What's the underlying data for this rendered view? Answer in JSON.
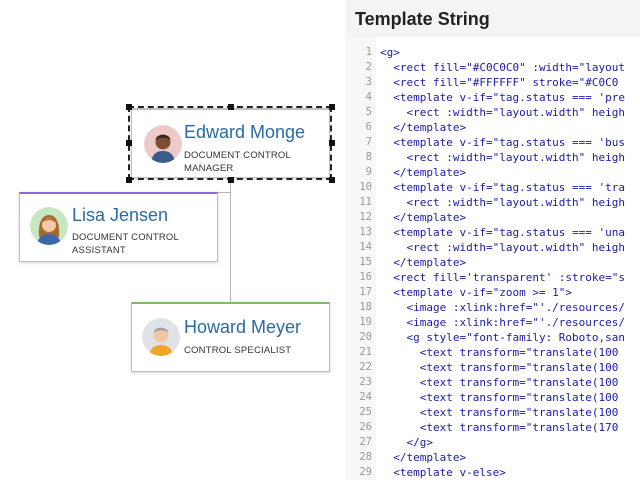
{
  "diagram": {
    "nodes": [
      {
        "id": "edward",
        "name": "Edward Monge",
        "role": "DOCUMENT CONTROL MANAGER",
        "accent": "#C0C0C0"
      },
      {
        "id": "lisa",
        "name": "Lisa Jensen",
        "role": "DOCUMENT CONTROL ASSISTANT",
        "accent": "#8C6AD6"
      },
      {
        "id": "howard",
        "name": "Howard Meyer",
        "role": "CONTROL SPECIALIST",
        "accent": "#7DBB6A"
      }
    ]
  },
  "panel": {
    "title": "Template String"
  },
  "editor": {
    "lines": [
      {
        "n": "1",
        "text": "<g>"
      },
      {
        "n": "2",
        "text": "  <rect fill=\"#C0C0C0\" :width=\"layout"
      },
      {
        "n": "3",
        "text": "  <rect fill=\"#FFFFFF\" stroke=\"#C0C0"
      },
      {
        "n": "4",
        "text": "  <template v-if=\"tag.status === 'pre"
      },
      {
        "n": "5",
        "text": "    <rect :width=\"layout.width\" heigh"
      },
      {
        "n": "6",
        "text": "  </template>"
      },
      {
        "n": "7",
        "text": "  <template v-if=\"tag.status === 'bus"
      },
      {
        "n": "8",
        "text": "    <rect :width=\"layout.width\" heigh"
      },
      {
        "n": "9",
        "text": "  </template>"
      },
      {
        "n": "10",
        "text": "  <template v-if=\"tag.status === 'tra"
      },
      {
        "n": "11",
        "text": "    <rect :width=\"layout.width\" heigh"
      },
      {
        "n": "12",
        "text": "  </template>"
      },
      {
        "n": "13",
        "text": "  <template v-if=\"tag.status === 'una"
      },
      {
        "n": "14",
        "text": "    <rect :width=\"layout.width\" heigh"
      },
      {
        "n": "15",
        "text": "  </template>"
      },
      {
        "n": "16",
        "text": "  <rect fill='transparent' :stroke=\"s"
      },
      {
        "n": "17",
        "text": "  <template v-if=\"zoom >= 1\">"
      },
      {
        "n": "18",
        "text": "    <image :xlink:href=\"'./resources/"
      },
      {
        "n": "19",
        "text": "    <image :xlink:href=\"'./resources/"
      },
      {
        "n": "20",
        "text": "    <g style=\"font-family: Roboto,san"
      },
      {
        "n": "21",
        "text": "      <text transform=\"translate(100"
      },
      {
        "n": "22",
        "text": "      <text transform=\"translate(100"
      },
      {
        "n": "23",
        "text": "      <text transform=\"translate(100"
      },
      {
        "n": "24",
        "text": "      <text transform=\"translate(100"
      },
      {
        "n": "25",
        "text": "      <text transform=\"translate(100"
      },
      {
        "n": "26",
        "text": "      <text transform=\"translate(170"
      },
      {
        "n": "27",
        "text": "    </g>"
      },
      {
        "n": "28",
        "text": "  </template>"
      },
      {
        "n": "29",
        "text": "  <template v-else>"
      }
    ]
  }
}
